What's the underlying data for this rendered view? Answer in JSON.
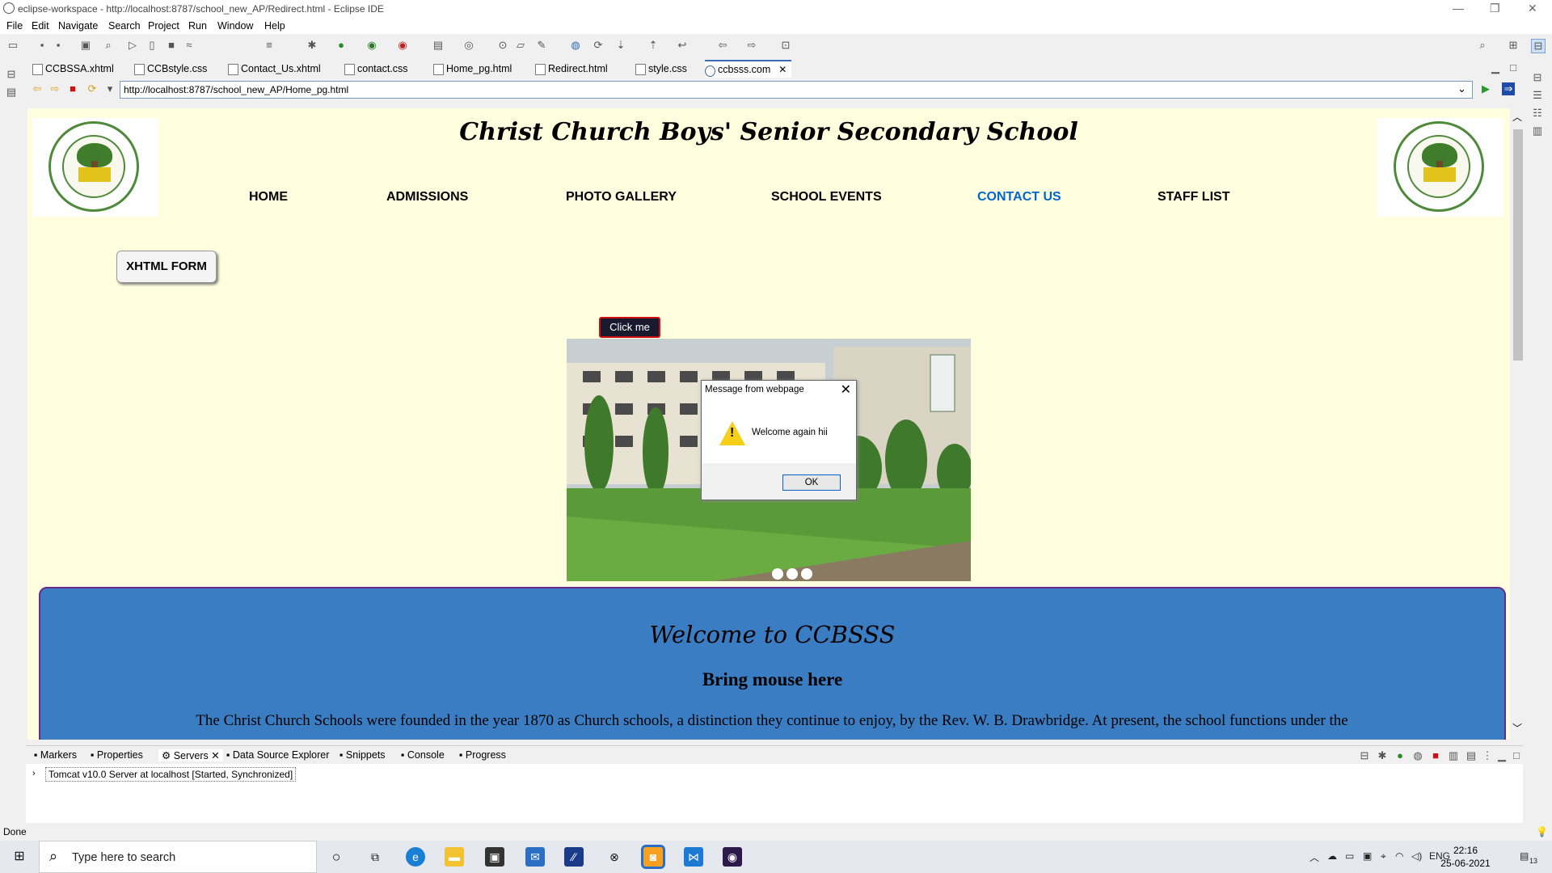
{
  "window": {
    "title": "eclipse-workspace - http://localhost:8787/school_new_AP/Redirect.html - Eclipse IDE"
  },
  "menu": [
    "File",
    "Edit",
    "Navigate",
    "Search",
    "Project",
    "Run",
    "Window",
    "Help"
  ],
  "editor_tabs": [
    {
      "label": "CCBSSA.xhtml",
      "active": false
    },
    {
      "label": "CCBstyle.css",
      "active": false
    },
    {
      "label": "Contact_Us.xhtml",
      "active": false
    },
    {
      "label": "contact.css",
      "active": false
    },
    {
      "label": "Home_pg.html",
      "active": false
    },
    {
      "label": "Redirect.html",
      "active": false
    },
    {
      "label": "style.css",
      "active": false
    },
    {
      "label": "ccbsss.com",
      "active": true
    }
  ],
  "browser": {
    "url": "http://localhost:8787/school_new_AP/Home_pg.html"
  },
  "page": {
    "school_title": "Christ Church Boys' Senior Secondary School",
    "nav": [
      {
        "label": "HOME",
        "active": false
      },
      {
        "label": "ADMISSIONS",
        "active": false
      },
      {
        "label": "PHOTO GALLERY",
        "active": false
      },
      {
        "label": "SCHOOL EVENTS",
        "active": false
      },
      {
        "label": "CONTACT US",
        "active": true
      },
      {
        "label": "STAFF LIST",
        "active": false
      }
    ],
    "xhtml_button": "XHTML FORM",
    "click_button": "Click me",
    "slideshow_dots": 3,
    "welcome": {
      "title": "Welcome to CCBSSS",
      "subtitle": "Bring mouse here",
      "text": "The Christ Church Schools were founded in the year 1870 as Church schools, a distinction they continue to enjoy, by the Rev. W. B. Drawbridge. At present, the school functions under the"
    }
  },
  "dialog": {
    "title": "Message from webpage",
    "message": "Welcome again hii",
    "ok_label": "OK",
    "close_label": "✕",
    "icon": "warning-icon"
  },
  "bottom_panel": {
    "tabs": [
      "Markers",
      "Properties",
      "Servers",
      "Data Source Explorer",
      "Snippets",
      "Console",
      "Progress"
    ],
    "server_entry": "Tomcat v10.0 Server at localhost  [Started, Synchronized]"
  },
  "status": "Done",
  "taskbar": {
    "search_placeholder": "Type here to search",
    "time": "22:16",
    "date": "25-06-2021",
    "language": "ENG",
    "notification_count": "13"
  },
  "colors": {
    "page_background": "#ffffe0",
    "welcome_background": "#3a7dc2",
    "contact_link": "#0066cc",
    "click_button_border": "#d01010"
  }
}
